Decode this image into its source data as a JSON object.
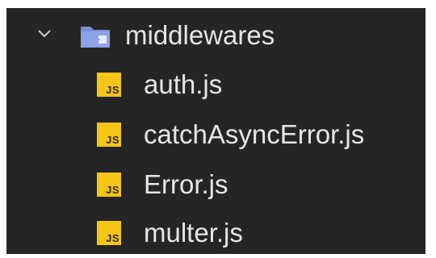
{
  "explorer": {
    "folder": {
      "label": "middlewares",
      "expanded": true,
      "chevron_icon": "chevron-down-icon",
      "icon": "folder-middleware-icon"
    },
    "files": [
      {
        "label": "auth.js",
        "icon": "js-file-icon",
        "badge": "JS"
      },
      {
        "label": "catchAsyncError.js",
        "icon": "js-file-icon",
        "badge": "JS"
      },
      {
        "label": "Error.js",
        "icon": "js-file-icon",
        "badge": "JS"
      },
      {
        "label": "multer.js",
        "icon": "js-file-icon",
        "badge": "JS"
      }
    ]
  },
  "colors": {
    "background": "#252526",
    "text": "#e6e6e6",
    "js_badge": "#f5c518",
    "folder_icon": "#7a8fd6"
  }
}
